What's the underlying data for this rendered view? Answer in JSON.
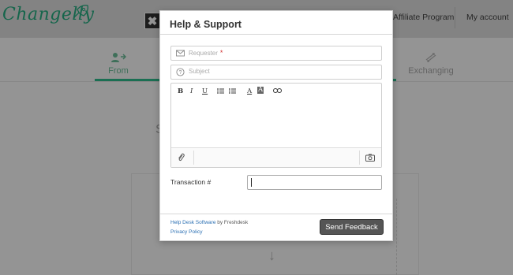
{
  "app": {
    "logo_text": "Changelly",
    "close_label": "✖",
    "nav": {
      "affiliate_label": "Affiliate Program",
      "account_label": "My account"
    },
    "steps": [
      {
        "label": "From"
      },
      {
        "label": "Exchanging"
      }
    ],
    "partial_text": "S"
  },
  "modal": {
    "title": "Help & Support",
    "requester_placeholder": "Requester",
    "requester_required_mark": "*",
    "subject_placeholder": "Subject",
    "toolbar": {
      "bold": "B",
      "italic": "I",
      "underline": "U",
      "font_color": "A",
      "background_color": "A"
    },
    "transaction_label": "Transaction #",
    "transaction_value": "",
    "footer": {
      "credit_link": "Help Desk Software",
      "credit_suffix": " by Freshdesk",
      "privacy_label": "Privacy Policy"
    },
    "send_label": "Send Feedback"
  },
  "colors": {
    "brand": "#27b083",
    "active_step": "#2fbf8f",
    "send_button": "#555555",
    "link": "#2a6fb3"
  }
}
